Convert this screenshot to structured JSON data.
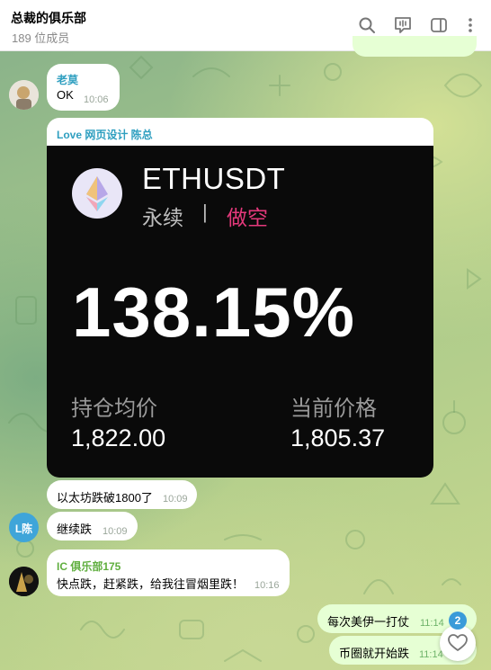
{
  "header": {
    "title": "总裁的俱乐部",
    "subtitle": "189 位成员",
    "icons": [
      "search-icon",
      "video-chat-icon",
      "sidebar-toggle-icon",
      "more-vertical-icon"
    ]
  },
  "messages": [
    {
      "id": "m1",
      "sender": "老莫",
      "text": "OK",
      "time": "10:06",
      "direction": "in",
      "sender_color": "#2f9fc0"
    },
    {
      "id": "m2",
      "sender": "Love 网页设计 陈总",
      "time": "",
      "direction": "in",
      "sender_color": "#2f9fc0"
    },
    {
      "id": "m3",
      "text": "以太坊跌破1800了",
      "time": "10:09",
      "direction": "in"
    },
    {
      "id": "m4",
      "text": "继续跌",
      "time": "10:09",
      "direction": "in",
      "avatar_text": "L陈",
      "avatar_color": "#3fa5d9"
    },
    {
      "id": "m5",
      "sender": "IC 俱乐部175",
      "text": "快点跌，赶紧跌，给我往冒烟里跌！",
      "time": "10:16",
      "direction": "in",
      "sender_color": "#5fae3e"
    },
    {
      "id": "m6",
      "text": "每次美伊一打仗",
      "time": "11:14",
      "direction": "out"
    },
    {
      "id": "m7",
      "text": "币圈就开始跌",
      "time": "11:14",
      "direction": "out"
    }
  ],
  "trade_card": {
    "symbol": "ETHUSDT",
    "contract_type": "永续",
    "separator": "|",
    "side": "做空",
    "pnl_percent": "138.15%",
    "entry_label": "持仓均价",
    "entry_price": "1,822.00",
    "mark_label": "当前价格",
    "mark_price": "1,805.37",
    "colors": {
      "short": "#e6397c",
      "background": "#0a0a0a"
    }
  },
  "reactions": {
    "count": "2",
    "icon": "heart-icon"
  },
  "colors": {
    "accent": "#3a9bd9",
    "outgoing_bubble": "#e6ffd4",
    "incoming_bubble": "#ffffff"
  }
}
